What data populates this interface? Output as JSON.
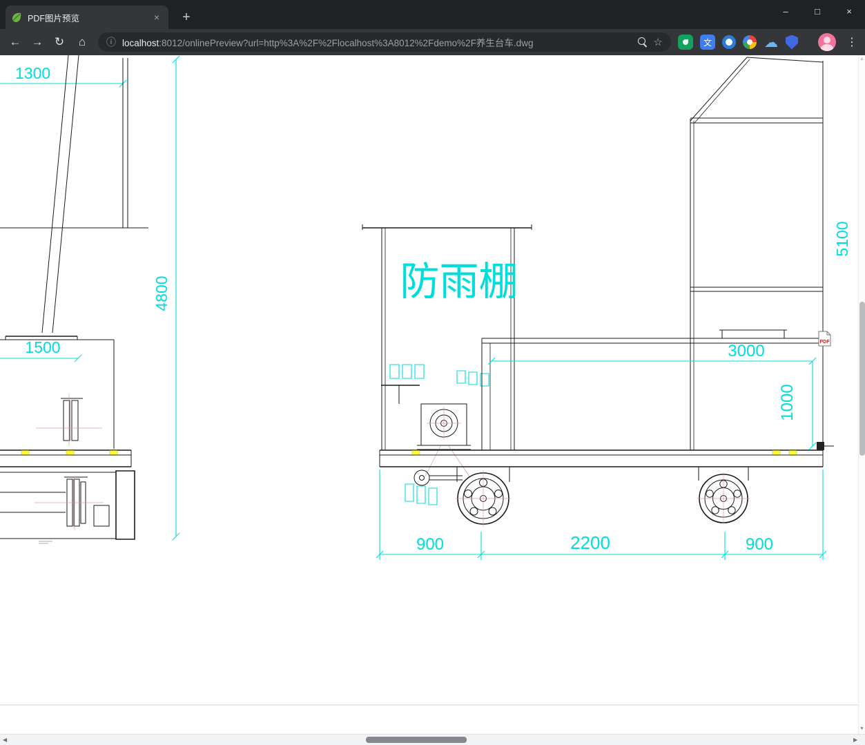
{
  "window": {
    "controls": {
      "minimize": "–",
      "maximize": "□",
      "close": "×"
    }
  },
  "tabstrip": {
    "tab_title": "PDF图片预览",
    "tab_close_glyph": "×",
    "new_tab_glyph": "+"
  },
  "toolbar": {
    "icons": {
      "back": "←",
      "forward": "→",
      "reload": "↻",
      "home": "⌂",
      "page_info": "ⓘ",
      "bookmark_star": "☆",
      "menu": "⋮",
      "translate_glyph": "文",
      "cloud_glyph": "☁"
    },
    "url": {
      "host": "localhost",
      "rest": ":8012/onlinePreview?url=http%3A%2F%2Flocalhost%3A8012%2Fdemo%2F养生台车.dwg"
    }
  },
  "scrollbars": {
    "up": "▲",
    "down": "▼",
    "left": "◀",
    "right": "▶"
  },
  "viewer": {
    "pdf_badge": "PDF",
    "shelter_label": "防雨棚",
    "dimensions": {
      "d1300": "1300",
      "d4800": "4800",
      "d1500": "1500",
      "d5100": "5100",
      "d3000": "3000",
      "d1000": "1000",
      "d900_left": "900",
      "d2200": "2200",
      "d900_right": "900"
    },
    "colors": {
      "dimension_cyan": "#00dddd",
      "line_black": "#1a1a1a",
      "highlight_yellow": "#fff83b"
    }
  }
}
